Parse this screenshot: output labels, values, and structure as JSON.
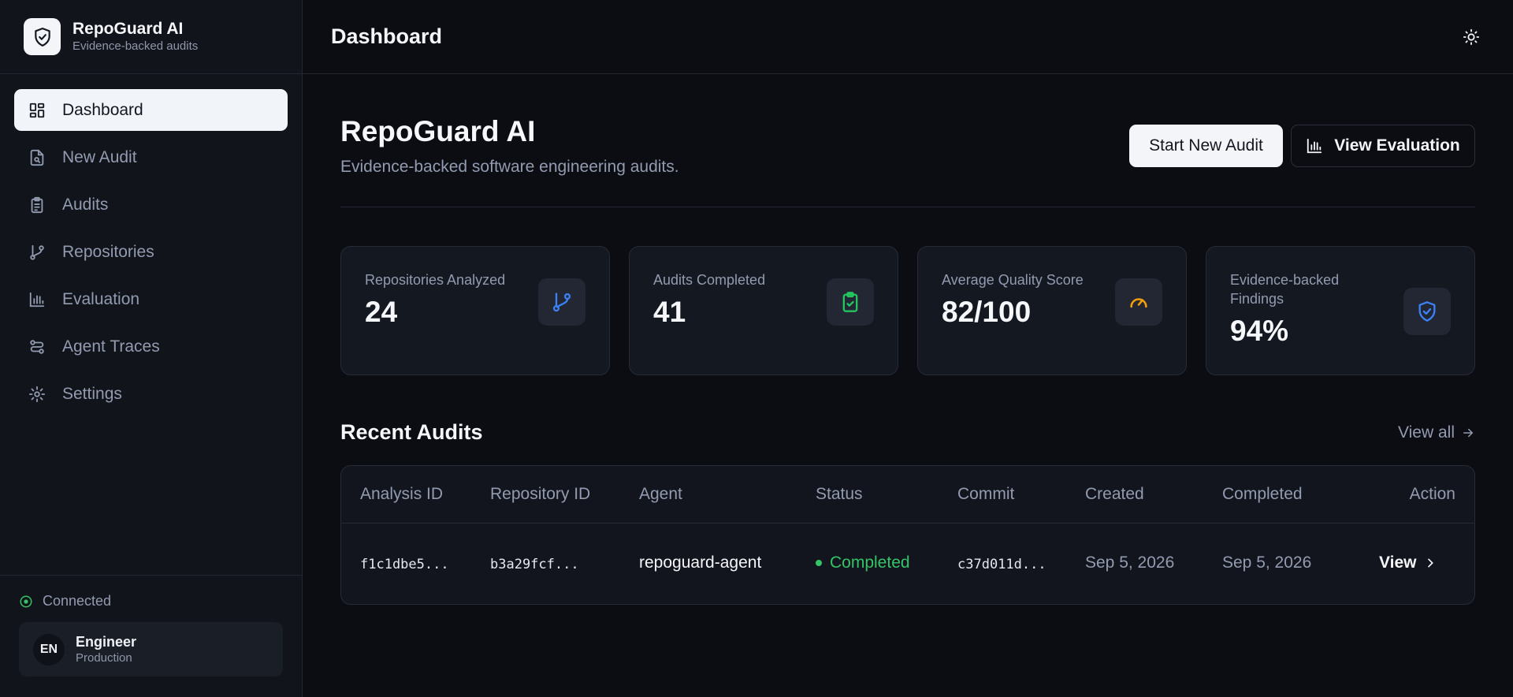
{
  "brand": {
    "title": "RepoGuard AI",
    "subtitle": "Evidence-backed audits"
  },
  "sidebar": {
    "items": [
      {
        "label": "Dashboard",
        "icon": "dashboard-icon",
        "active": true
      },
      {
        "label": "New Audit",
        "icon": "file-search-icon"
      },
      {
        "label": "Audits",
        "icon": "clipboard-list-icon"
      },
      {
        "label": "Repositories",
        "icon": "git-branch-icon"
      },
      {
        "label": "Evaluation",
        "icon": "bar-chart-icon"
      },
      {
        "label": "Agent Traces",
        "icon": "route-icon"
      },
      {
        "label": "Settings",
        "icon": "gear-icon"
      }
    ],
    "connection": "Connected",
    "user": {
      "initials": "EN",
      "name": "Engineer",
      "environment": "Production"
    }
  },
  "header": {
    "title": "Dashboard",
    "theme_icon": "sun-icon"
  },
  "hero": {
    "title": "RepoGuard AI",
    "subtitle": "Evidence-backed software engineering audits.",
    "primary_label": "Start New Audit",
    "secondary_label": "View Evaluation"
  },
  "stats": [
    {
      "label": "Repositories Analyzed",
      "value": "24",
      "icon": "git-branch-icon",
      "color": "#3b82f6"
    },
    {
      "label": "Audits Completed",
      "value": "41",
      "icon": "clipboard-check-icon",
      "color": "#22c55e"
    },
    {
      "label": "Average Quality Score",
      "value": "82/100",
      "icon": "gauge-icon",
      "color": "#f59e0b"
    },
    {
      "label": "Evidence-backed Findings",
      "value": "94%",
      "icon": "shield-check-icon",
      "color": "#3b82f6"
    }
  ],
  "recent": {
    "title": "Recent Audits",
    "view_all": "View all",
    "columns": [
      "Analysis ID",
      "Repository ID",
      "Agent",
      "Status",
      "Commit",
      "Created",
      "Completed",
      "Action"
    ],
    "rows": [
      {
        "analysis_id": "f1c1dbe5...",
        "repository_id": "b3a29fcf...",
        "agent": "repoguard-agent",
        "status": "Completed",
        "commit": "c37d011d...",
        "created": "Sep 5, 2026",
        "completed": "Sep 5, 2026",
        "action": "View"
      }
    ]
  },
  "colors": {
    "accent_blue": "#3b82f6",
    "success": "#34c466",
    "warning": "#f59e0b",
    "background": "#0b0d13"
  }
}
